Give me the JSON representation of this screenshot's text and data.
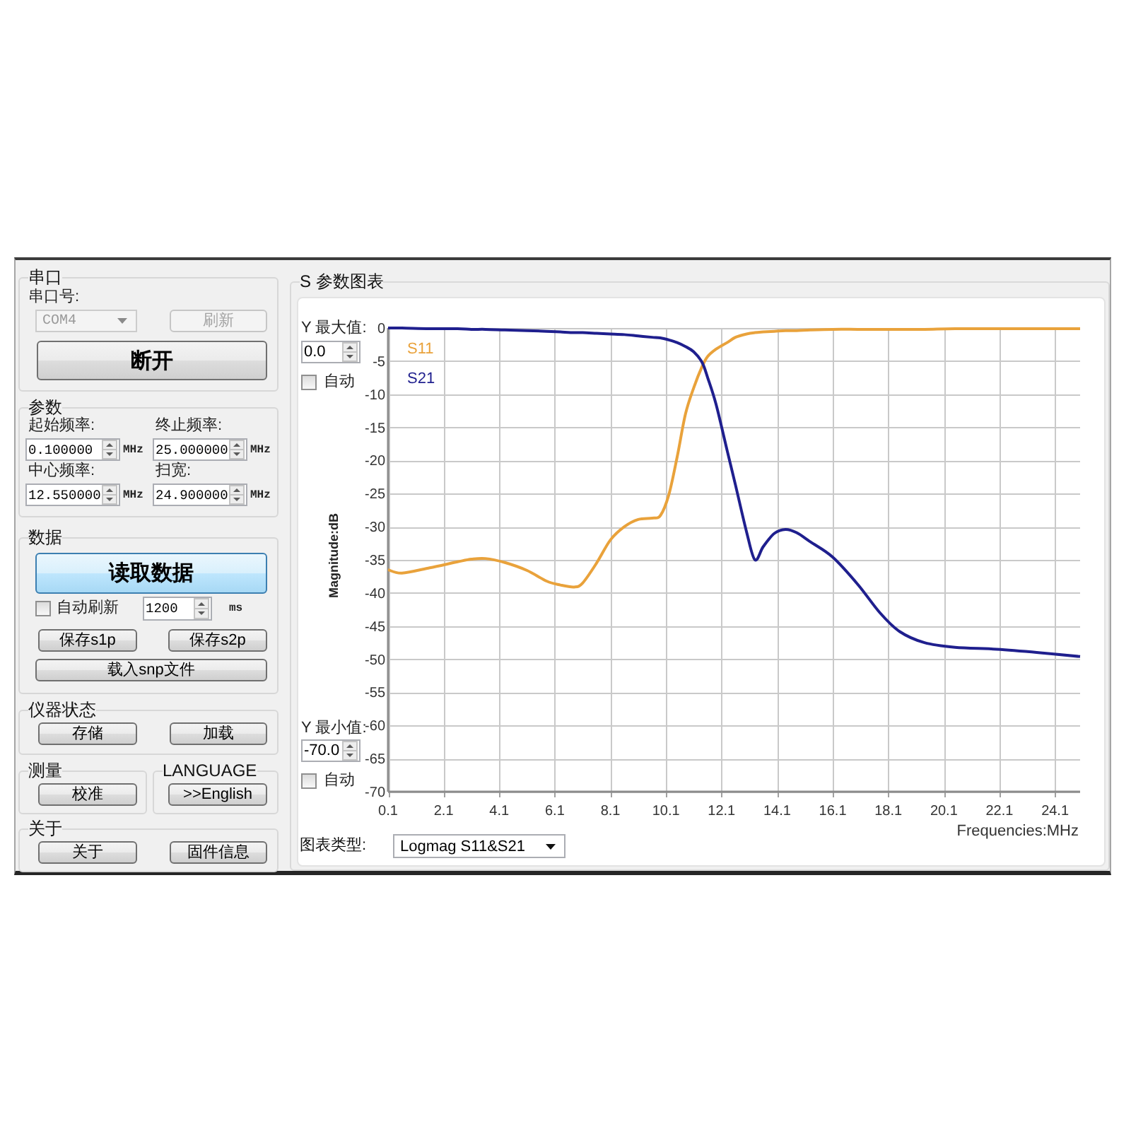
{
  "serial_port": {
    "title": "串口",
    "port_label": "串口号:",
    "port": {
      "value": "COM4",
      "disabled": true
    },
    "refresh_button": {
      "label": "刷新",
      "disabled": true
    },
    "connect_button": {
      "label": "断开"
    }
  },
  "parameters": {
    "title": "参数",
    "fields": [
      {
        "label": "起始频率:",
        "value": "0.100000",
        "unit": "MHz"
      },
      {
        "label": "终止频率:",
        "value": "25.000000",
        "unit": "MHz"
      },
      {
        "label": "中心频率:",
        "value": "12.550000",
        "unit": "MHz"
      },
      {
        "label": "扫宽:",
        "value": "24.900000",
        "unit": "MHz"
      }
    ]
  },
  "data": {
    "title": "数据",
    "read_button": {
      "label": "读取数据",
      "focused": true
    },
    "auto_refresh": {
      "label": "自动刷新",
      "checked": false
    },
    "interval": {
      "value": "1200",
      "unit": "ms"
    },
    "save_buttons": [
      "保存s1p",
      "保存s2p"
    ],
    "load_button": {
      "label": "载入snp文件"
    }
  },
  "instrument_state": {
    "title": "仪器状态",
    "buttons": [
      "存储",
      "加载"
    ]
  },
  "measurement": {
    "title": "测量",
    "buttons": [
      "校准"
    ]
  },
  "language": {
    "title": "LANGUAGE",
    "buttons": [
      ">>English"
    ]
  },
  "about": {
    "title": "关于",
    "buttons": [
      "关于",
      "固件信息"
    ]
  },
  "s_parameter_chart": {
    "title": "S 参数图表",
    "y_max": {
      "label": "Y 最大值:",
      "value": "0.0",
      "auto": {
        "label": "自动",
        "checked": false
      }
    },
    "y_min": {
      "label": "Y 最小值:",
      "value": "-70.0",
      "auto": {
        "label": "自动",
        "checked": false
      }
    },
    "chart_data": {
      "type": "line",
      "xlabel": "Frequencies:MHz",
      "ylabel": "Magnitude:dB",
      "grid": true,
      "x": [
        0.1,
        0.6,
        1.6,
        2.6,
        3.1,
        3.6,
        4.3,
        5.1,
        5.8,
        6.3,
        6.8,
        7.1,
        7.6,
        8.1,
        8.6,
        9.1,
        9.6,
        9.9,
        10.2,
        10.5,
        10.8,
        11.1,
        11.4,
        11.6,
        11.9,
        12.3,
        12.6,
        13.0,
        13.3,
        13.6,
        14.0,
        14.4,
        14.8,
        15.3,
        16.1,
        17.0,
        17.8,
        18.5,
        19.4,
        20.5,
        22.0,
        23.5,
        25.0
      ],
      "series": [
        {
          "name": "S11",
          "color": "#e9a23b",
          "values": [
            -36.5,
            -37.0,
            -36.2,
            -35.3,
            -34.9,
            -34.8,
            -35.4,
            -36.6,
            -38.2,
            -38.8,
            -39.1,
            -38.5,
            -35.5,
            -32.0,
            -30.0,
            -28.9,
            -28.7,
            -28.3,
            -25.2,
            -19.5,
            -13.0,
            -9.0,
            -5.8,
            -4.3,
            -3.2,
            -2.2,
            -1.4,
            -0.9,
            -0.7,
            -0.6,
            -0.5,
            -0.4,
            -0.4,
            -0.3,
            -0.2,
            -0.2,
            -0.2,
            -0.2,
            -0.2,
            -0.1,
            -0.1,
            -0.1,
            -0.1
          ]
        },
        {
          "name": "S21",
          "color": "#1f1f8e",
          "values": [
            0,
            0,
            -0.1,
            -0.1,
            -0.2,
            -0.2,
            -0.3,
            -0.4,
            -0.5,
            -0.6,
            -0.7,
            -0.7,
            -0.8,
            -0.9,
            -1.0,
            -1.2,
            -1.4,
            -1.5,
            -1.8,
            -2.2,
            -2.8,
            -3.6,
            -5.2,
            -7.5,
            -11.5,
            -18.5,
            -23.7,
            -30.8,
            -35.0,
            -33.0,
            -31.0,
            -30.4,
            -30.9,
            -32.3,
            -34.6,
            -38.7,
            -43.0,
            -45.8,
            -47.5,
            -48.2,
            -48.5,
            -49.0,
            -49.6
          ]
        }
      ],
      "xlim": [
        0.1,
        25.0
      ],
      "ylim": [
        -70,
        0
      ],
      "xticks": [
        0.1,
        2.1,
        4.1,
        6.1,
        8.1,
        10.1,
        12.1,
        14.1,
        16.1,
        18.1,
        20.1,
        22.1,
        24.1
      ],
      "yticks": [
        0,
        -5,
        -10,
        -15,
        -20,
        -25,
        -30,
        -35,
        -40,
        -45,
        -50,
        -55,
        -60,
        -65,
        -70
      ]
    },
    "chart_type": {
      "label": "图表类型:",
      "value": "Logmag S11&S21"
    }
  }
}
